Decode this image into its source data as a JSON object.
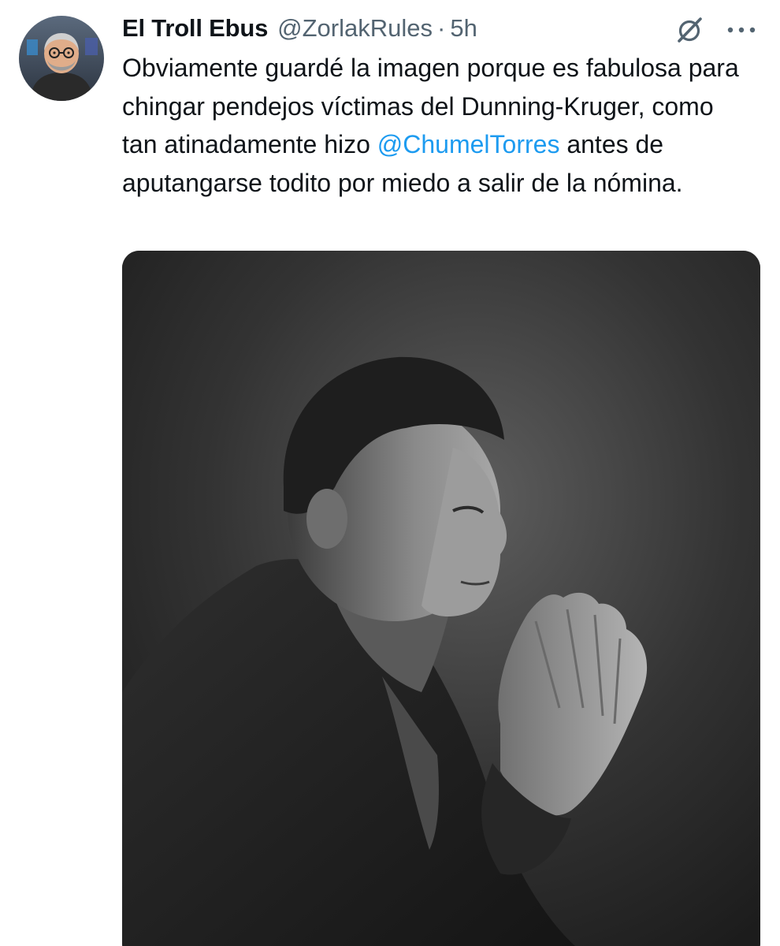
{
  "tweet": {
    "display_name": "El Troll Ebus",
    "handle": "@ZorlakRules",
    "separator": "·",
    "time": "5h",
    "text_part1": "Obviamente guardé la imagen porque es fabulosa para chingar pendejos víctimas del Dunning-Kruger, como tan atinadamente hizo ",
    "mention": "@ChumelTorres",
    "text_part2": " antes de aputangarse todito por miedo a salir de la nómina.",
    "avatar_icon": "user-avatar",
    "grok_icon": "grok-icon",
    "more_icon": "more-options-icon",
    "media_description_icon": "photo"
  },
  "colors": {
    "text": "#0f1419",
    "secondary": "#536471",
    "mention": "#1d9bf0",
    "background": "#ffffff"
  }
}
